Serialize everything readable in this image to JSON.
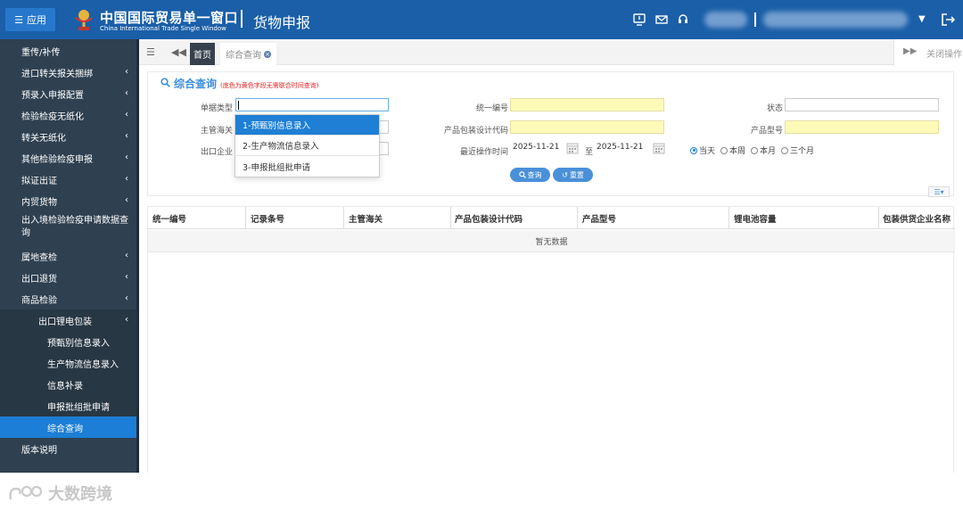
{
  "header": {
    "app_button_label": "应用",
    "brand_cn": "中国国际贸易单一窗口",
    "brand_en": "China International Trade Single Window",
    "page_title": "货物申报"
  },
  "sidebar": {
    "items": [
      {
        "label": "重传/补传",
        "has_children": false
      },
      {
        "label": "进口转关报关捆绑",
        "has_children": true
      },
      {
        "label": "预录入申报配置",
        "has_children": true
      },
      {
        "label": "检验检疫无纸化",
        "has_children": true
      },
      {
        "label": "转关无纸化",
        "has_children": true
      },
      {
        "label": "其他检验检疫申报",
        "has_children": true
      },
      {
        "label": "拟证出证",
        "has_children": true
      },
      {
        "label": "内贸货物",
        "has_children": true
      },
      {
        "label": "出入境检验检疫申请数据查询",
        "has_children": false
      },
      {
        "label": "属地查检",
        "has_children": true
      },
      {
        "label": "出口退货",
        "has_children": true
      },
      {
        "label": "商品检验",
        "has_children": true
      },
      {
        "label": "出口锂电包装",
        "has_children": true
      },
      {
        "label": "预甄别信息录入",
        "has_children": false
      },
      {
        "label": "生产物流信息录入",
        "has_children": false
      },
      {
        "label": "信息补录",
        "has_children": false
      },
      {
        "label": "申报批组批申请",
        "has_children": false
      },
      {
        "label": "综合查询",
        "has_children": false,
        "active": true
      },
      {
        "label": "版本说明",
        "has_children": false
      }
    ]
  },
  "tabs": {
    "home": "首页",
    "current": "综合查询",
    "close_ops": "关闭操作"
  },
  "search": {
    "title": "综合查询",
    "note": "(底色为黄色字段无需联合时间查询)",
    "labels": {
      "doc_type": "单据类型",
      "unified_no": "统一编号",
      "status": "状态",
      "customs": "主管海关",
      "pkg_code": "产品包装设计代码",
      "model": "产品型号",
      "exporter": "出口企业",
      "recent_time": "最近操作时间",
      "to": "至"
    },
    "date_from": "2025-11-21",
    "date_to": "2025-11-21",
    "radios": [
      "当天",
      "本周",
      "本月",
      "三个月"
    ],
    "radio_selected": "当天",
    "query_button": "查询",
    "reset_button": "重置",
    "doc_type_options": [
      "1-预甄别信息录入",
      "2-生产物流信息录入",
      "3-申报批组批申请"
    ],
    "doc_type_highlighted": "1-预甄别信息录入"
  },
  "table": {
    "columns": [
      "统一编号",
      "记录条号",
      "主管海关",
      "产品包装设计代码",
      "产品型号",
      "锂电池容量",
      "包装供货企业名称"
    ],
    "empty_text": "暂无数据"
  },
  "watermark": "大数跨境",
  "colors": {
    "header_bg": "#1a5fa8",
    "sidebar_bg": "#2f4050",
    "active_item": "#1c7ed6",
    "required_yellow": "#fdfab8"
  }
}
